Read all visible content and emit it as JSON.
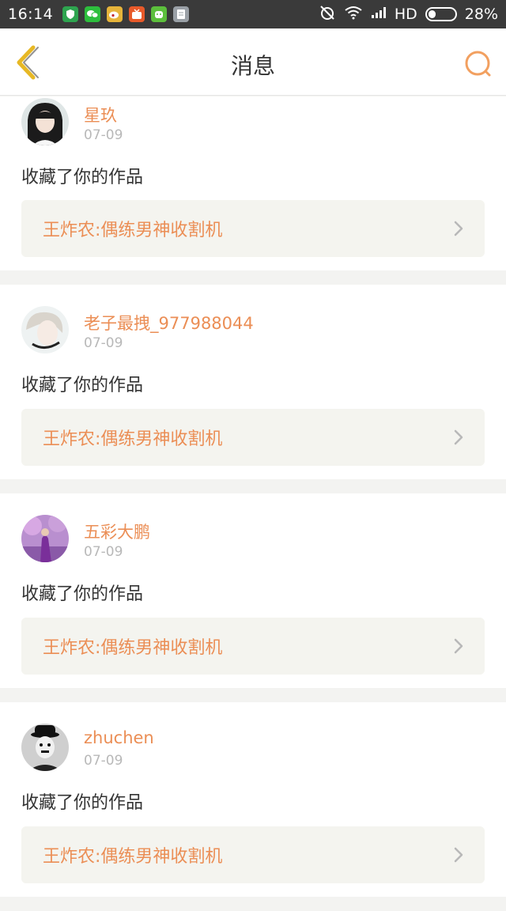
{
  "status_bar": {
    "time": "16:14",
    "network": "HD",
    "battery": "28%",
    "apps": [
      {
        "icon": "shield-app-icon",
        "color": "#2ea44f"
      },
      {
        "icon": "wechat-icon",
        "color": "#2dbe3d"
      },
      {
        "icon": "weibo-icon",
        "color": "#e6b43a"
      },
      {
        "icon": "tv-app-icon",
        "color": "#e85a2a"
      },
      {
        "icon": "robot-app-icon",
        "color": "#5cbf3c"
      },
      {
        "icon": "notes-app-icon",
        "color": "#9aa0a6"
      }
    ]
  },
  "header": {
    "title": "消息",
    "back_icon": "chevron-left-icon",
    "search_icon": "search-icon",
    "accent_back": "#e7b825",
    "accent_search": "#f2a060"
  },
  "messages": [
    {
      "user": "星玖",
      "date": "07-09",
      "action": "收藏了你的作品",
      "work": "王炸农:偶练男神收割机"
    },
    {
      "user": "老子最拽_977988044",
      "date": "07-09",
      "action": "收藏了你的作品",
      "work": "王炸农:偶练男神收割机"
    },
    {
      "user": "五彩大鹏",
      "date": "07-09",
      "action": "收藏了你的作品",
      "work": "王炸农:偶练男神收割机"
    },
    {
      "user": "zhuchen",
      "date": "07-09",
      "action": "收藏了你的作品",
      "work": "王炸农:偶练男神收割机"
    }
  ],
  "colors": {
    "name": "#eb8e55",
    "date": "#b8b8b8",
    "link_bg": "#f4f4ef"
  }
}
